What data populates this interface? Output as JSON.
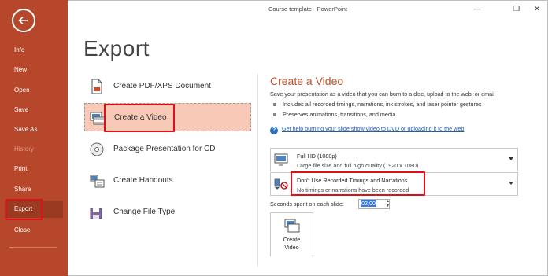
{
  "window": {
    "title": "Course template - PowerPoint",
    "minimize": "—",
    "restore": "❐",
    "close": "✕"
  },
  "nav": {
    "back_icon": "back-arrow-icon",
    "items": [
      {
        "label": "Info"
      },
      {
        "label": "New"
      },
      {
        "label": "Open"
      },
      {
        "label": "Save"
      },
      {
        "label": "Save As"
      },
      {
        "label": "History"
      },
      {
        "label": "Print"
      },
      {
        "label": "Share"
      },
      {
        "label": "Export"
      },
      {
        "label": "Close"
      }
    ]
  },
  "export": {
    "title": "Export",
    "options": [
      {
        "label": "Create PDF/XPS Document",
        "icon": "pdf-document-icon"
      },
      {
        "label": "Create a Video",
        "icon": "video-icon"
      },
      {
        "label": "Package Presentation for CD",
        "icon": "cd-icon"
      },
      {
        "label": "Create Handouts",
        "icon": "handouts-icon"
      },
      {
        "label": "Change File Type",
        "icon": "file-type-icon"
      }
    ]
  },
  "video": {
    "title": "Create a Video",
    "description": "Save your presentation as a video that you can burn to a disc, upload to the web, or email",
    "bullets": [
      "Includes all recorded timings, narrations, ink strokes, and laser pointer gestures",
      "Preserves animations, transitions, and media"
    ],
    "help_link": "Get help burning your slide show video to DVD or uploading it to the web",
    "quality": {
      "title": "Full HD (1080p)",
      "subtitle": "Large file size and full high quality (1920 x 1080)"
    },
    "timings": {
      "title": "Don't Use Recorded Timings and Narrations",
      "subtitle": "No timings or narrations have been recorded"
    },
    "seconds_label": "Seconds spent on each slide:",
    "seconds_value": "02,00",
    "create_button_line1": "Create",
    "create_button_line2": "Video"
  },
  "colors": {
    "nav_bg": "#b7472a",
    "accent": "#c0502a",
    "selected_bg": "#f8c9b6",
    "highlight_red": "#e0101a",
    "link": "#1f5ea8"
  }
}
